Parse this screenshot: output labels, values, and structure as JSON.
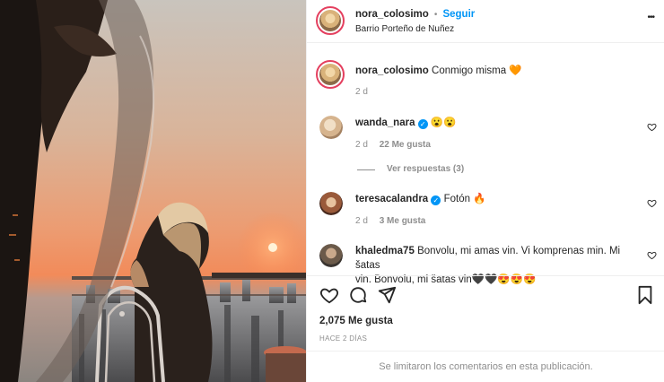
{
  "post": {
    "author": "nora_colosimo",
    "follow_label": "Seguir",
    "separator": "•",
    "location": "Barrio Porteño de Nuñez",
    "more_label": "•••"
  },
  "caption": {
    "username": "nora_colosimo",
    "text": "Conmigo misma 🧡",
    "time": "2 d"
  },
  "comments": [
    {
      "username": "wanda_nara",
      "verified": true,
      "text": "😮😮",
      "time": "2 d",
      "likes": "22 Me gusta",
      "replies": "Ver respuestas (3)"
    },
    {
      "username": "teresacalandra",
      "verified": true,
      "text": "Fotón 🔥",
      "time": "2 d",
      "likes": "3 Me gusta"
    },
    {
      "username": "khaledma75",
      "verified": false,
      "text_line1": "Bonvolu, mi amas vin. Vi komprenas min. Mi šatas",
      "text_line2": "vin. Bonvolu, mi šatas vin🖤🖤😍😍😍"
    }
  ],
  "stats": {
    "likes": "2,075 Me gusta",
    "date": "HACE 2 DÍAS"
  },
  "footer": {
    "notice": "Se limitaron los comentarios en esta publicación."
  },
  "colors": {
    "accent_blue": "#0095f6",
    "muted": "#8e8e8e",
    "sunset": "#e86a3a"
  }
}
